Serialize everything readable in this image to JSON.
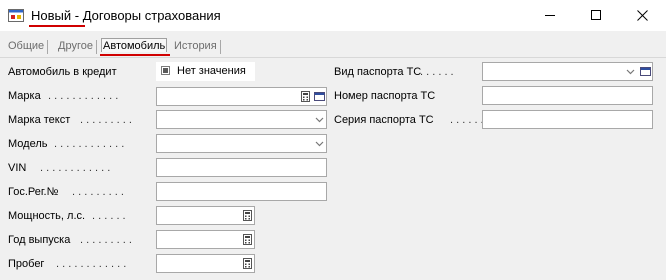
{
  "window": {
    "title_new": "Новый",
    "title_rest": " - Договоры страхования",
    "icon": "app-form-icon",
    "controls": [
      "minimize-icon",
      "maximize-icon",
      "close-icon"
    ]
  },
  "tabs": [
    "Общие",
    "Другое",
    "Автомобиль",
    "История"
  ],
  "active_tab": "Автомобиль",
  "left_fields": {
    "credit": {
      "label": "Автомобиль в кредит",
      "value": "Нет значения"
    },
    "brand": {
      "label": "Марка",
      "value": ""
    },
    "brand_text": {
      "label": "Марка текст",
      "value": ""
    },
    "model": {
      "label": "Модель",
      "value": ""
    },
    "vin": {
      "label": "VIN",
      "value": ""
    },
    "reg_no": {
      "label": "Гос.Рег.№",
      "value": ""
    },
    "power": {
      "label": "Мощность, л.с.",
      "value": ""
    },
    "year": {
      "label": "Год выпуска",
      "value": ""
    },
    "mileage": {
      "label": "Пробег",
      "value": ""
    }
  },
  "right_fields": {
    "passport_type": {
      "label": "Вид паспорта ТС",
      "value": ""
    },
    "passport_no": {
      "label": "Номер паспорта ТС",
      "value": ""
    },
    "passport_series": {
      "label": "Серия паспорта ТС",
      "value": ""
    }
  },
  "dots_long": ". . . . . . . . . . . .",
  "dots_med": ". . . . . . . . .",
  "dots_short": ". . . . . ."
}
